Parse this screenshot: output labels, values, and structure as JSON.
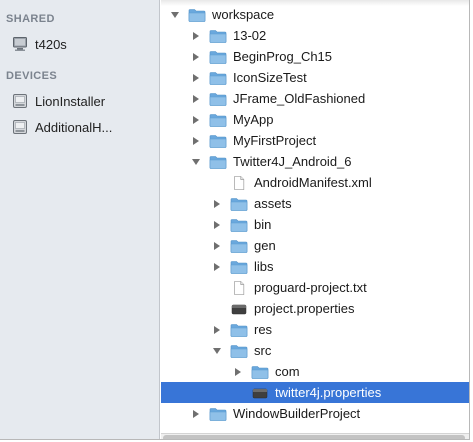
{
  "sidebar": {
    "shared_header": "SHARED",
    "shared_items": [
      {
        "label": "t420s",
        "icon": "computer-icon"
      }
    ],
    "devices_header": "DEVICES",
    "device_items": [
      {
        "label": "LionInstaller",
        "icon": "disk-image-icon"
      },
      {
        "label": "AdditionalH...",
        "icon": "disk-image-icon"
      }
    ]
  },
  "file_list": {
    "selected": "twitter4j.properties",
    "rows": [
      {
        "label": "workspace",
        "type": "folder",
        "level": 0,
        "expanded": true
      },
      {
        "label": "13-02",
        "type": "folder",
        "level": 1,
        "expanded": false
      },
      {
        "label": "BeginProg_Ch15",
        "type": "folder",
        "level": 1,
        "expanded": false
      },
      {
        "label": "IconSizeTest",
        "type": "folder",
        "level": 1,
        "expanded": false
      },
      {
        "label": "JFrame_OldFashioned",
        "type": "folder",
        "level": 1,
        "expanded": false
      },
      {
        "label": "MyApp",
        "type": "folder",
        "level": 1,
        "expanded": false
      },
      {
        "label": "MyFirstProject",
        "type": "folder",
        "level": 1,
        "expanded": false
      },
      {
        "label": "Twitter4J_Android_6",
        "type": "folder",
        "level": 1,
        "expanded": true
      },
      {
        "label": "AndroidManifest.xml",
        "type": "document",
        "level": 2
      },
      {
        "label": "assets",
        "type": "folder",
        "level": 2,
        "expanded": false
      },
      {
        "label": "bin",
        "type": "folder",
        "level": 2,
        "expanded": false
      },
      {
        "label": "gen",
        "type": "folder",
        "level": 2,
        "expanded": false
      },
      {
        "label": "libs",
        "type": "folder",
        "level": 2,
        "expanded": false
      },
      {
        "label": "proguard-project.txt",
        "type": "document",
        "level": 2
      },
      {
        "label": "project.properties",
        "type": "properties",
        "level": 2
      },
      {
        "label": "res",
        "type": "folder",
        "level": 2,
        "expanded": false
      },
      {
        "label": "src",
        "type": "folder",
        "level": 2,
        "expanded": true
      },
      {
        "label": "com",
        "type": "folder",
        "level": 3,
        "expanded": false
      },
      {
        "label": "twitter4j.properties",
        "type": "properties",
        "level": 3,
        "selected": true
      },
      {
        "label": "WindowBuilderProject",
        "type": "folder",
        "level": 1,
        "expanded": false
      }
    ]
  },
  "colors": {
    "sidebar_bg": "#e6eaef",
    "selection": "#3875d7",
    "folder": "#8fc0e8",
    "triangle": "#6f6f6f"
  }
}
